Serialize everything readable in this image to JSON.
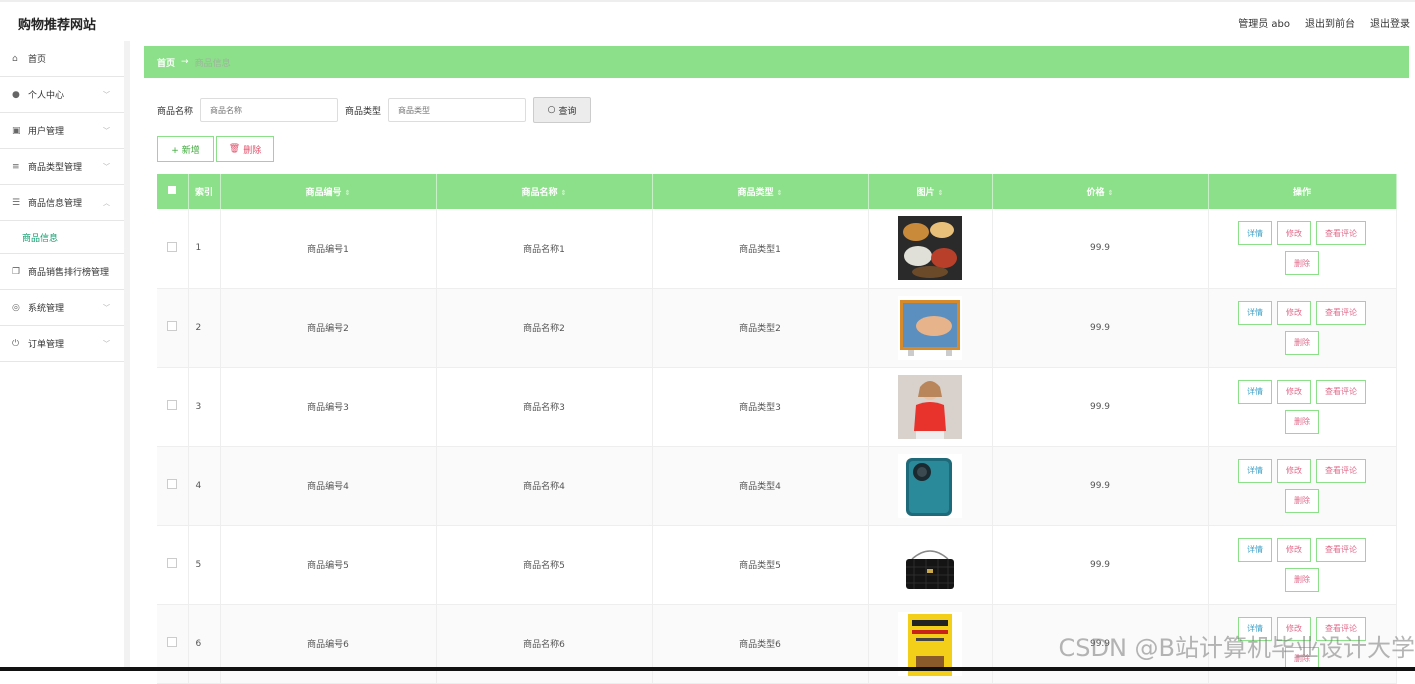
{
  "header": {
    "brand": "购物推荐网站",
    "admin": "管理员 abo",
    "back_to_front": "退出到前台",
    "logout": "退出登录"
  },
  "sidebar": {
    "items": [
      {
        "label": "首页",
        "icon": "home-icon",
        "glyph": "⌂"
      },
      {
        "label": "个人中心",
        "icon": "user-icon",
        "glyph": "●"
      },
      {
        "label": "用户管理",
        "icon": "clipboard-icon",
        "glyph": "▣"
      },
      {
        "label": "商品类型管理",
        "icon": "stack-icon",
        "glyph": "≡"
      },
      {
        "label": "商品信息管理",
        "icon": "list-icon",
        "glyph": "☰"
      }
    ],
    "sub_item": "商品信息",
    "items_after": [
      {
        "label": "商品销售排行榜管理",
        "icon": "copy-icon",
        "glyph": "❐"
      },
      {
        "label": "系统管理",
        "icon": "compass-icon",
        "glyph": "◎"
      },
      {
        "label": "订单管理",
        "icon": "power-icon",
        "glyph": "⏻"
      }
    ]
  },
  "breadcrumb": {
    "home": "首页",
    "arrow": "→",
    "current": "商品信息"
  },
  "search": {
    "name_label": "商品名称",
    "name_placeholder": "商品名称",
    "type_label": "商品类型",
    "type_placeholder": "商品类型",
    "query_label": "查询"
  },
  "actions": {
    "add_label": "+ 新增",
    "delete_label": "删除"
  },
  "table": {
    "headers": [
      "索引",
      "商品编号",
      "商品名称",
      "商品类型",
      "图片",
      "价格",
      "操作"
    ],
    "row_buttons": {
      "detail": "详情",
      "edit": "修改",
      "review": "查看评论",
      "remove": "删除"
    },
    "rows": [
      {
        "index": "1",
        "code": "商品编号1",
        "name": "商品名称1",
        "type": "商品类型1",
        "image": "food-bento-image",
        "price": "99.9"
      },
      {
        "index": "2",
        "code": "商品编号2",
        "name": "商品名称2",
        "type": "商品类型2",
        "image": "tv-image",
        "price": "99.9"
      },
      {
        "index": "3",
        "code": "商品编号3",
        "name": "商品名称3",
        "type": "商品类型3",
        "image": "woman-red-top-image",
        "price": "99.9"
      },
      {
        "index": "4",
        "code": "商品编号4",
        "name": "商品名称4",
        "type": "商品类型4",
        "image": "smartphone-image",
        "price": "99.9"
      },
      {
        "index": "5",
        "code": "商品编号5",
        "name": "商品名称5",
        "type": "商品类型5",
        "image": "black-handbag-image",
        "price": "99.9"
      },
      {
        "index": "6",
        "code": "商品编号6",
        "name": "商品名称6",
        "type": "商品类型6",
        "image": "yellow-book-image",
        "price": "99.9"
      }
    ]
  },
  "watermark": "CSDN @B站计算机毕业设计大学",
  "colors": {
    "accent_green": "#8ce08a",
    "active_text": "#0e9f6e"
  }
}
